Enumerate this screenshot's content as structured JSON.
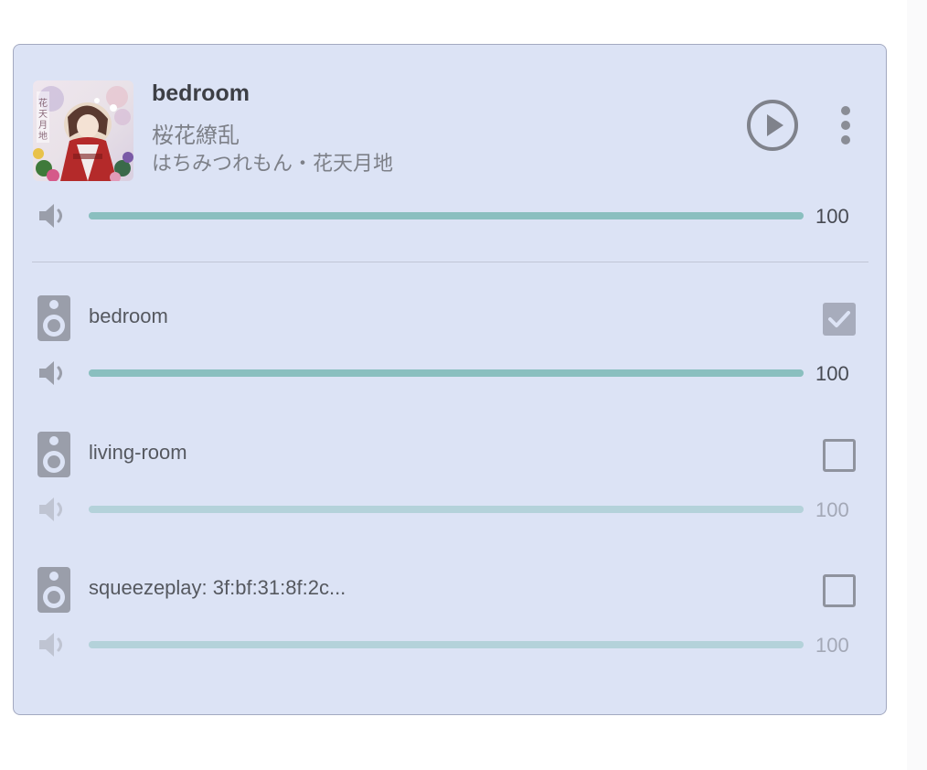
{
  "media": {
    "title": "bedroom",
    "track": "桜花繚乱",
    "artist": "はちみつれもん・花天月地",
    "art_text": "花天月地"
  },
  "master_volume": {
    "value": "100",
    "level": 1.0
  },
  "devices": [
    {
      "name": "bedroom",
      "checked": true,
      "volume": "100",
      "level": 1.0,
      "enabled": true
    },
    {
      "name": "living-room",
      "checked": false,
      "volume": "100",
      "level": 1.0,
      "enabled": false
    },
    {
      "name": "squeezeplay: 3f:bf:31:8f:2c...",
      "checked": false,
      "volume": "100",
      "level": 1.0,
      "enabled": false
    }
  ],
  "colors": {
    "card_bg": "#dce3f5",
    "card_border": "#a3a9c0",
    "slider_active": "#8abfbf",
    "slider_dim": "#b4d2da",
    "icon": "#9a9eaa",
    "icon_dim": "#bfc4d2",
    "checkbox_on": "#a7acbc",
    "checkbox_off_border": "#8f939e"
  },
  "icons": {
    "play": "play-circle-icon",
    "menu": "dots-vertical-icon",
    "volume": "volume-icon",
    "speaker": "speaker-icon",
    "check": "check-icon"
  }
}
